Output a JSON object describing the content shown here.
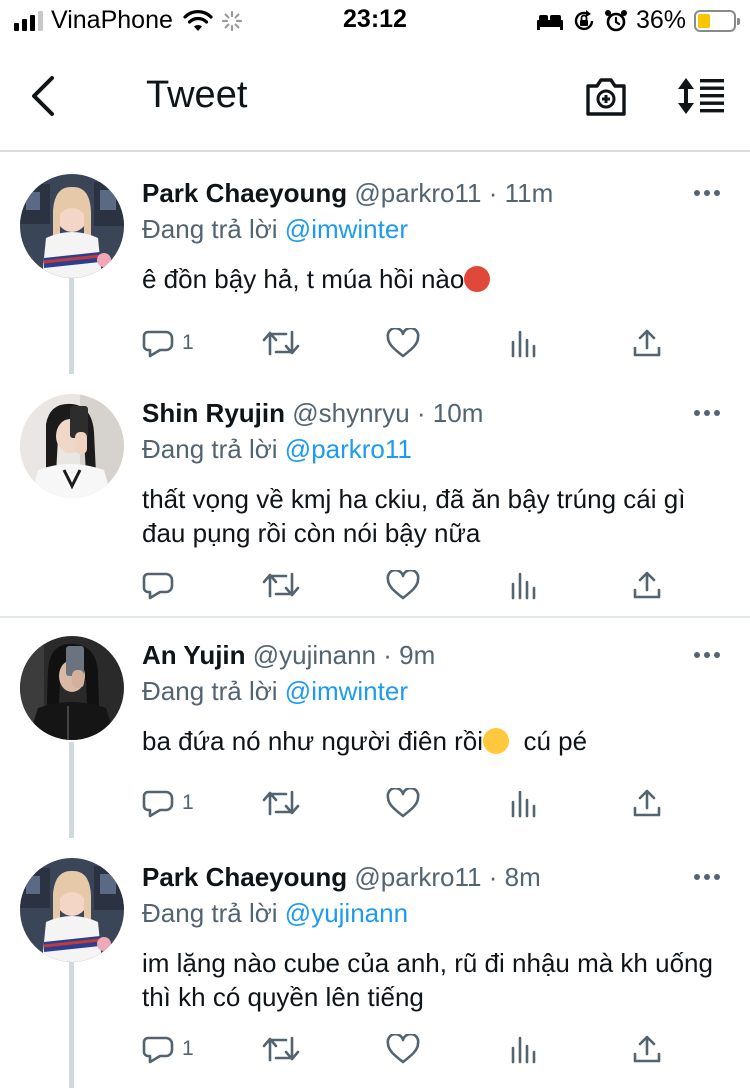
{
  "status_bar": {
    "carrier": "VinaPhone",
    "time": "23:12",
    "battery_pct": "36%",
    "battery_level": 0.36,
    "icons": [
      "signal-icon",
      "wifi-icon",
      "loading-icon",
      "bed-icon",
      "rotation-lock-icon",
      "alarm-icon",
      "battery-icon"
    ]
  },
  "header": {
    "title": "Tweet",
    "icons": [
      "back-arrow-icon",
      "camera-add-icon",
      "sort-icon"
    ]
  },
  "tweets": [
    {
      "name": "Park Chaeyoung",
      "handle": "@parkro11",
      "time": "· 11m",
      "reply_prefix": "Đang trả lời",
      "reply_to": "@imwinter",
      "text": "ê đồn bậy hả, t múa hồi nào",
      "emoji": "angry-face-emoji",
      "reply_count": "1"
    },
    {
      "name": "Shin Ryujin",
      "handle": "@shynryu",
      "time": "· 10m",
      "reply_prefix": "Đang trả lời",
      "reply_to": "@parkro11",
      "text": "thất vọng về kmj ha ckiu, đã ăn bậy trúng cái gì đau pụng rồi còn nói bậy nữa",
      "reply_count": ""
    },
    {
      "name": "An Yujin",
      "handle": "@yujinann",
      "time": "· 9m",
      "reply_prefix": "Đang trả lời",
      "reply_to": "@imwinter",
      "text_before": "ba đứa nó như người điên rồi",
      "text_after": "  cú pé",
      "emoji": "pensive-face-emoji",
      "reply_count": "1"
    },
    {
      "name": "Park Chaeyoung",
      "handle": "@parkro11",
      "time": "· 8m",
      "reply_prefix": "Đang trả lời",
      "reply_to": "@yujinann",
      "text": "im lặng nào cube của anh, rũ đi nhậu mà kh uống thì kh có quyền lên tiếng",
      "reply_count": "1"
    }
  ],
  "action_icons": [
    "reply-icon",
    "retweet-icon",
    "like-icon",
    "stats-icon",
    "share-icon"
  ],
  "colors": {
    "link": "#1d9bf0",
    "secondary_text": "#536471",
    "primary_text": "#0f1419",
    "divider": "#e1e6ea"
  }
}
